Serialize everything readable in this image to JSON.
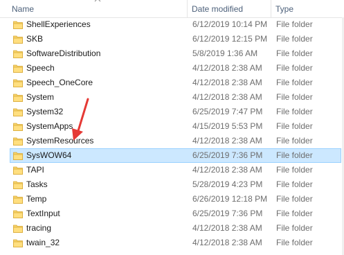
{
  "columns": {
    "name": "Name",
    "date_modified": "Date modified",
    "type": "Type"
  },
  "sort_icon": "chevron-up-icon",
  "folder_icon": "folder-icon",
  "colors": {
    "folder": "#f6d36b",
    "selection": "#cce8ff",
    "selection_border": "#99d1ff",
    "arrow": "#e53935",
    "header_text": "#4c607a"
  },
  "rows": [
    {
      "name": "ShellExperiences",
      "date": "6/12/2019 10:14 PM",
      "type": "File folder"
    },
    {
      "name": "SKB",
      "date": "6/12/2019 12:15 PM",
      "type": "File folder"
    },
    {
      "name": "SoftwareDistribution",
      "date": "5/8/2019 1:36 AM",
      "type": "File folder"
    },
    {
      "name": "Speech",
      "date": "4/12/2018 2:38 AM",
      "type": "File folder"
    },
    {
      "name": "Speech_OneCore",
      "date": "4/12/2018 2:38 AM",
      "type": "File folder"
    },
    {
      "name": "System",
      "date": "4/12/2018 2:38 AM",
      "type": "File folder"
    },
    {
      "name": "System32",
      "date": "6/25/2019 7:47 PM",
      "type": "File folder"
    },
    {
      "name": "SystemApps",
      "date": "4/15/2019 5:53 PM",
      "type": "File folder"
    },
    {
      "name": "SystemResources",
      "date": "4/12/2018 2:38 AM",
      "type": "File folder"
    },
    {
      "name": "SysWOW64",
      "date": "6/25/2019 7:36 PM",
      "type": "File folder",
      "selected": true
    },
    {
      "name": "TAPI",
      "date": "4/12/2018 2:38 AM",
      "type": "File folder"
    },
    {
      "name": "Tasks",
      "date": "5/28/2019 4:23 PM",
      "type": "File folder"
    },
    {
      "name": "Temp",
      "date": "6/26/2019 12:18 PM",
      "type": "File folder"
    },
    {
      "name": "TextInput",
      "date": "6/25/2019 7:36 PM",
      "type": "File folder"
    },
    {
      "name": "tracing",
      "date": "4/12/2018 2:38 AM",
      "type": "File folder"
    },
    {
      "name": "twain_32",
      "date": "4/12/2018 2:38 AM",
      "type": "File folder"
    }
  ]
}
